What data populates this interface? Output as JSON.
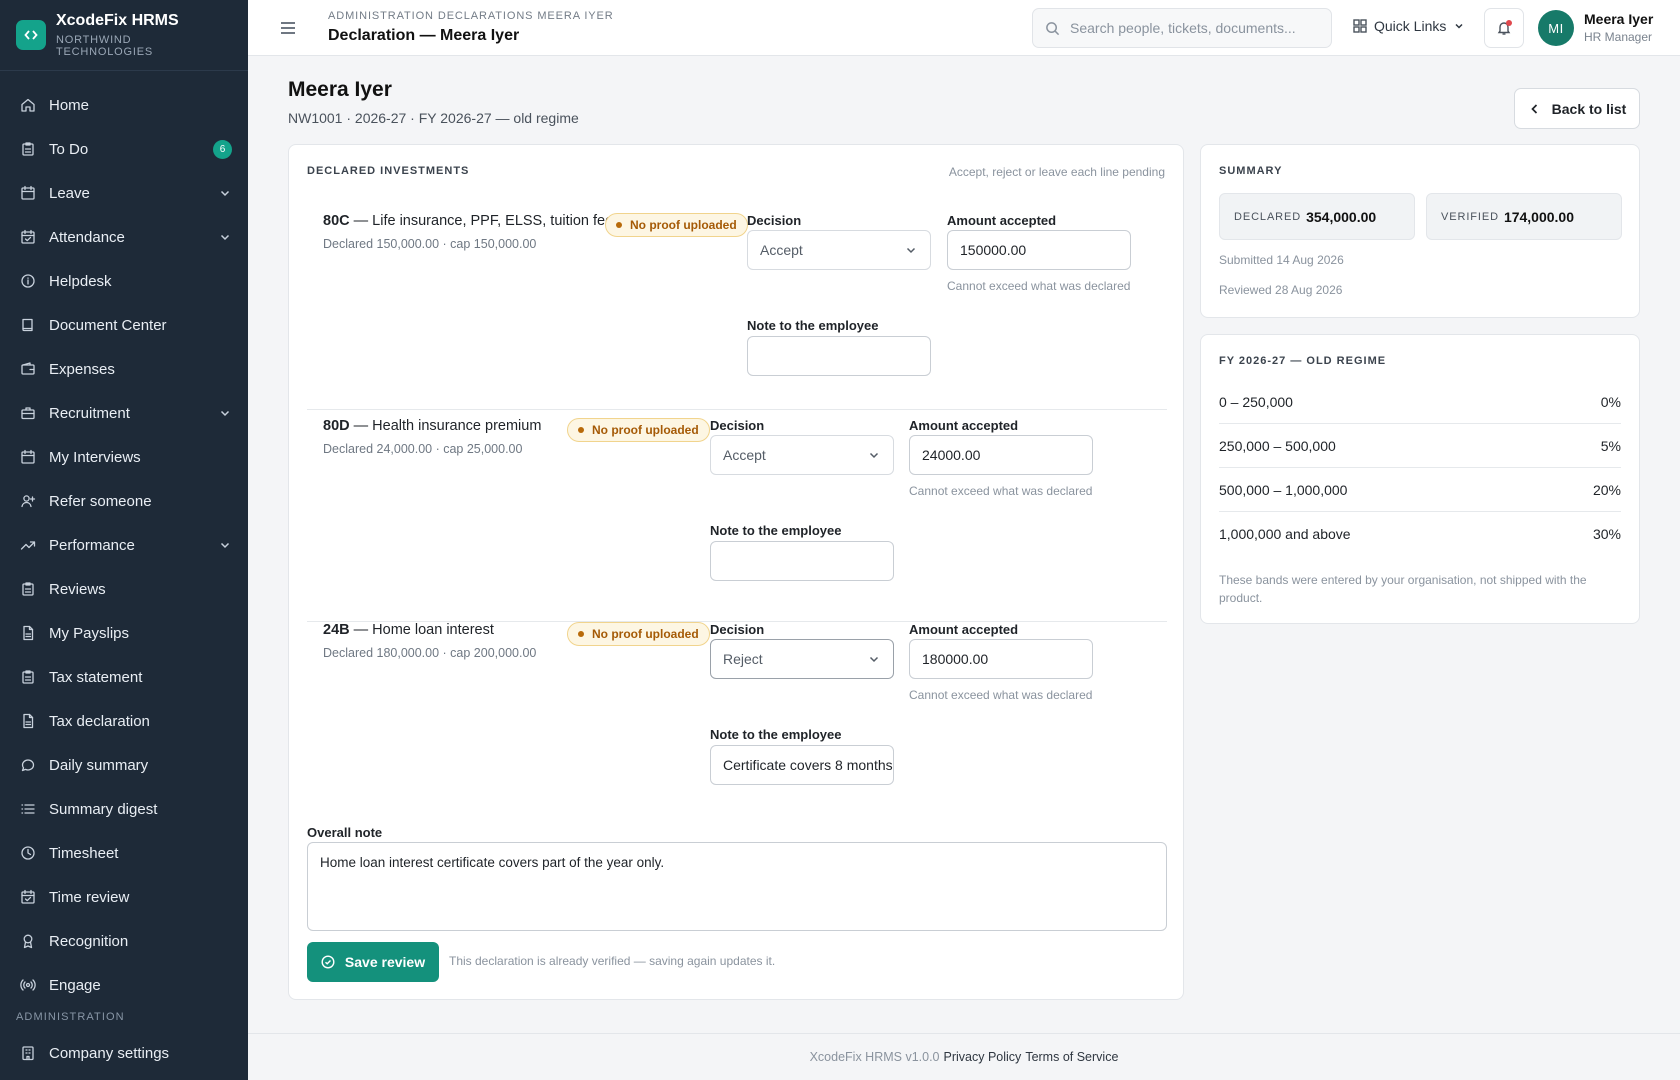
{
  "brand": {
    "name": "XcodeFix HRMS",
    "org": "NORTHWIND TECHNOLOGIES"
  },
  "sidebar": {
    "items": [
      {
        "label": "Home",
        "icon": "home-icon"
      },
      {
        "label": "To Do",
        "icon": "clipboard-icon",
        "badge": "6"
      },
      {
        "label": "Leave",
        "icon": "calendar-icon",
        "expandable": true
      },
      {
        "label": "Attendance",
        "icon": "calendar-check-icon",
        "expandable": true
      },
      {
        "label": "Helpdesk",
        "icon": "info-icon"
      },
      {
        "label": "Document Center",
        "icon": "book-icon"
      },
      {
        "label": "Expenses",
        "icon": "wallet-icon"
      },
      {
        "label": "Recruitment",
        "icon": "briefcase-icon",
        "expandable": true
      },
      {
        "label": "My Interviews",
        "icon": "calendar-icon"
      },
      {
        "label": "Refer someone",
        "icon": "user-plus-icon"
      },
      {
        "label": "Performance",
        "icon": "trending-up-icon",
        "expandable": true
      },
      {
        "label": "Reviews",
        "icon": "clipboard-icon"
      },
      {
        "label": "My Payslips",
        "icon": "file-icon"
      },
      {
        "label": "Tax statement",
        "icon": "clipboard-icon"
      },
      {
        "label": "Tax declaration",
        "icon": "file-icon"
      },
      {
        "label": "Daily summary",
        "icon": "message-icon"
      },
      {
        "label": "Summary digest",
        "icon": "list-icon"
      },
      {
        "label": "Timesheet",
        "icon": "clock-icon"
      },
      {
        "label": "Time review",
        "icon": "calendar-check-icon"
      },
      {
        "label": "Recognition",
        "icon": "award-icon"
      },
      {
        "label": "Engage",
        "icon": "broadcast-icon"
      }
    ],
    "section_admin": "ADMINISTRATION",
    "admin_items": [
      {
        "label": "Company settings",
        "icon": "building-icon"
      }
    ]
  },
  "topbar": {
    "breadcrumb": "ADMINISTRATION  DECLARATIONS  MEERA IYER",
    "title": "Declaration — Meera Iyer",
    "search_placeholder": "Search people, tickets, documents...",
    "quick_links": "Quick Links",
    "user": {
      "initials": "MI",
      "name": "Meera Iyer",
      "role": "HR Manager"
    }
  },
  "header": {
    "name": "Meera Iyer",
    "sub": "NW1001 · 2026-27 · FY 2026-27 — old regime",
    "back": "Back to list"
  },
  "investments": {
    "heading": "DECLARED INVESTMENTS",
    "hint": "Accept, reject or leave each line pending",
    "labels": {
      "decision": "Decision",
      "amount": "Amount accepted",
      "note": "Note to the employee",
      "helper": "Cannot exceed what was declared"
    },
    "lines": [
      {
        "code": "80C",
        "desc": " — Life insurance, PPF, ELSS, tuition fees",
        "sub": "Declared 150,000.00 · cap 150,000.00",
        "proof": "No proof uploaded",
        "decision": "Accept",
        "amount": "150000.00",
        "note": ""
      },
      {
        "code": "80D",
        "desc": " — Health insurance premium",
        "sub": "Declared 24,000.00 · cap 25,000.00",
        "proof": "No proof uploaded",
        "decision": "Accept",
        "amount": "24000.00",
        "note": ""
      },
      {
        "code": "24B",
        "desc": " — Home loan interest",
        "sub": "Declared 180,000.00 · cap 200,000.00",
        "proof": "No proof uploaded",
        "decision": "Reject",
        "amount": "180000.00",
        "note": "Certificate covers 8 months"
      }
    ],
    "overall_label": "Overall note",
    "overall_note": "Home loan interest certificate covers part of the year only.",
    "save": "Save review",
    "save_hint": "This declaration is already verified — saving again updates it."
  },
  "summary": {
    "heading": "SUMMARY",
    "declared_label": "DECLARED",
    "declared_value": "354,000.00",
    "verified_label": "VERIFIED",
    "verified_value": "174,000.00",
    "submitted": "Submitted 14 Aug 2026",
    "reviewed": "Reviewed 28 Aug 2026"
  },
  "regime": {
    "heading": "FY 2026-27 — OLD REGIME",
    "bands": [
      {
        "range": "0 – 250,000",
        "rate": "0%"
      },
      {
        "range": "250,000 – 500,000",
        "rate": "5%"
      },
      {
        "range": "500,000 – 1,000,000",
        "rate": "20%"
      },
      {
        "range": "1,000,000 and above",
        "rate": "30%"
      }
    ],
    "note": "These bands were entered by your organisation, not shipped with the product."
  },
  "footer": {
    "version": "XcodeFix HRMS v1.0.0",
    "privacy": "Privacy Policy",
    "terms": "Terms of Service"
  },
  "colors": {
    "sidebar": "#1e2a38",
    "accent": "#14917c",
    "warning": "#a55a06"
  }
}
